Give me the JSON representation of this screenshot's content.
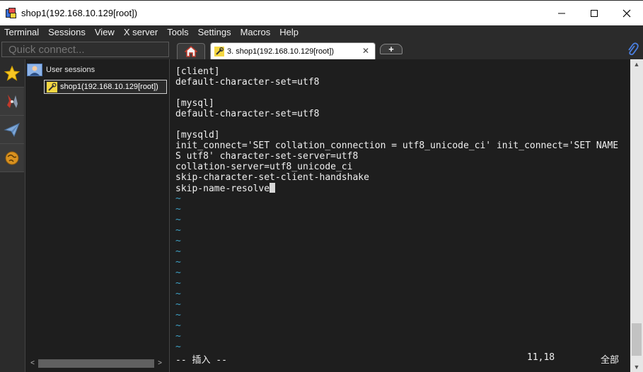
{
  "window": {
    "title": "shop1(192.168.10.129[root])",
    "minimize": "—",
    "maximize": "☐",
    "close": "✕"
  },
  "menu": [
    "Terminal",
    "Sessions",
    "View",
    "X server",
    "Tools",
    "Settings",
    "Macros",
    "Help"
  ],
  "quick_connect": {
    "placeholder": "Quick connect..."
  },
  "tabs": {
    "home_icon": "home-icon",
    "session_label": "3. shop1(192.168.10.129[root])",
    "close": "✕",
    "new_tab": "+"
  },
  "sidebar": {
    "buttons": [
      "star-icon",
      "tools-icon",
      "paper-plane-icon",
      "globe-icon"
    ],
    "root_label": "User sessions",
    "session_label": "shop1(192.168.10.129[root])"
  },
  "terminal": {
    "lines": [
      "[client]",
      "default-character-set=utf8",
      "",
      "[mysql]",
      "default-character-set=utf8",
      "",
      "[mysqld]",
      "init_connect='SET collation_connection = utf8_unicode_ci' init_connect='SET NAME",
      "S utf8' character-set-server=utf8",
      "collation-server=utf8_unicode_ci",
      "skip-character-set-client-handshake",
      "skip-name-resolve"
    ],
    "tilde": "~",
    "tilde_count": 15,
    "mode": "-- 插入 --",
    "position": "11,18",
    "scroll_pos": "全部"
  },
  "colors": {
    "background": "#1e1e1e",
    "text": "#f0f0f0",
    "tilde": "#3fa3c8",
    "chrome": "#2b2b2b"
  }
}
